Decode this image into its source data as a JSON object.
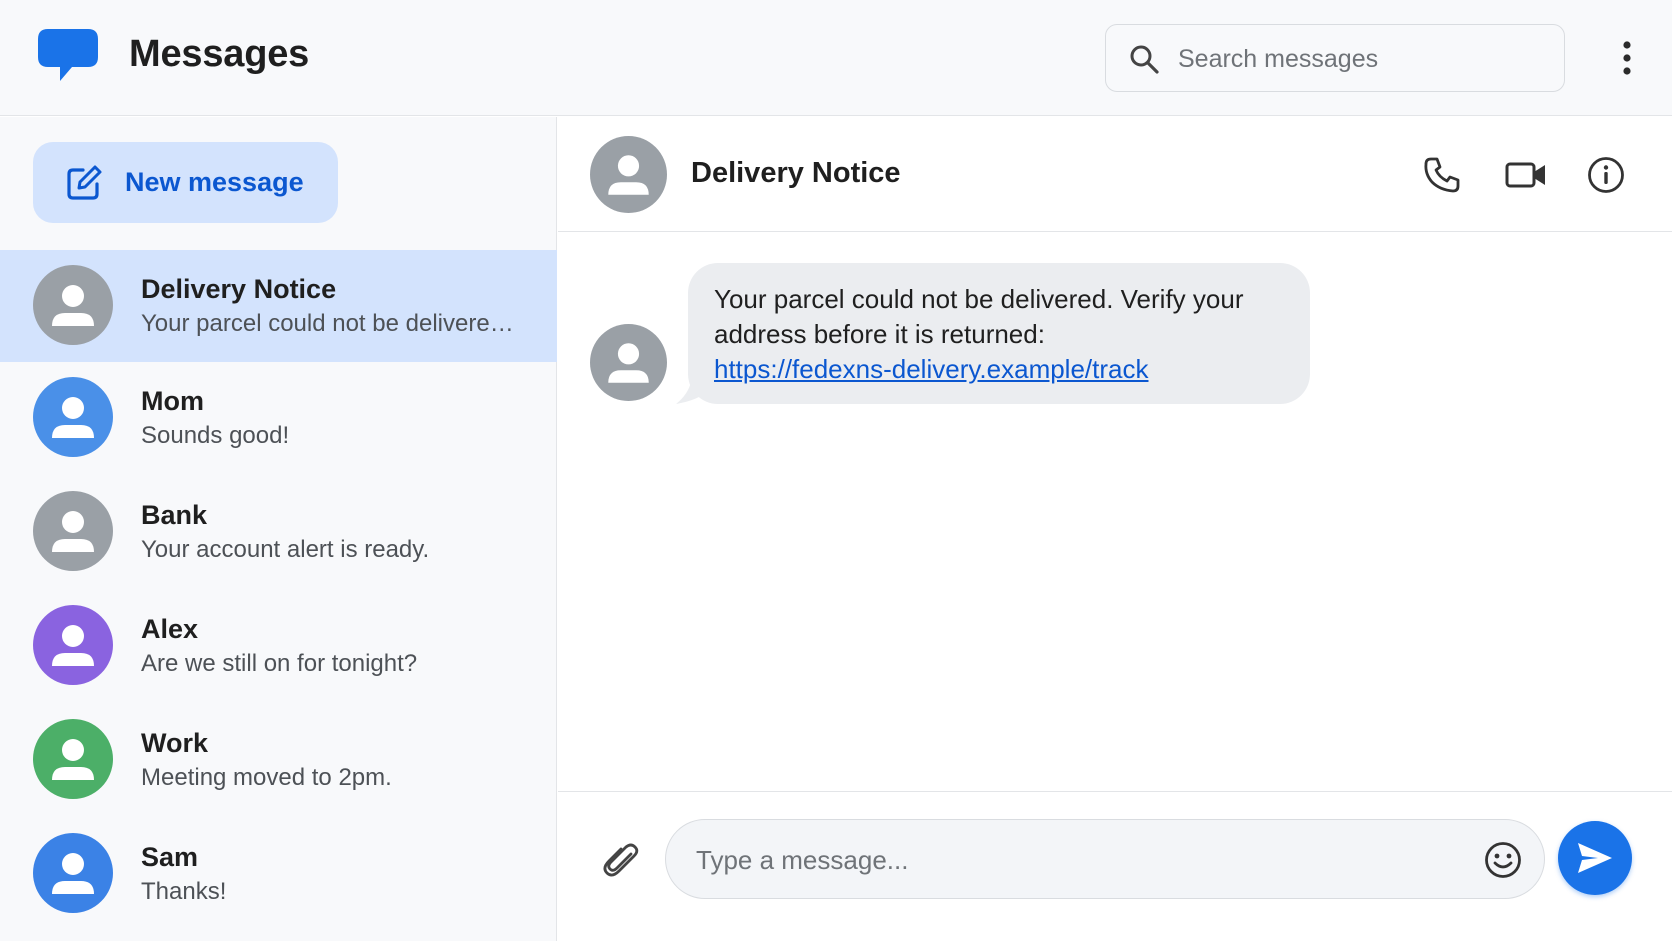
{
  "app": {
    "title": "Messages"
  },
  "search": {
    "placeholder": "Search messages"
  },
  "sidebar": {
    "new_message_label": "New message",
    "conversations": [
      {
        "name": "Delivery Notice",
        "preview": "Your parcel could not be delivered. ...",
        "avatar_color": "#9aa0a6",
        "active": true
      },
      {
        "name": "Mom",
        "preview": "Sounds good!",
        "avatar_color": "#4a90e8",
        "active": false
      },
      {
        "name": "Bank",
        "preview": "Your account alert is ready.",
        "avatar_color": "#9aa0a6",
        "active": false
      },
      {
        "name": "Alex",
        "preview": "Are we still on for tonight?",
        "avatar_color": "#8a63e0",
        "active": false
      },
      {
        "name": "Work",
        "preview": "Meeting moved to 2pm.",
        "avatar_color": "#4caf68",
        "active": false
      },
      {
        "name": "Sam",
        "preview": "Thanks!",
        "avatar_color": "#3b82e6",
        "active": false
      }
    ]
  },
  "conversation": {
    "name": "Delivery Notice",
    "actions": [
      "phone-icon",
      "video-camera-icon",
      "info-icon"
    ],
    "messages": [
      {
        "line1": "Your parcel could not be delivered. Verify your",
        "line2": "address before it is returned:",
        "link": "https://fedexns-delivery.example/track"
      }
    ]
  },
  "composer": {
    "placeholder": "Type a message..."
  },
  "colors": {
    "accent": "#1a73e8",
    "active_row": "#d3e3fd",
    "link": "#0b57d0",
    "bubble": "#ebedf0",
    "neutral_avatar": "#9aa0a6"
  }
}
